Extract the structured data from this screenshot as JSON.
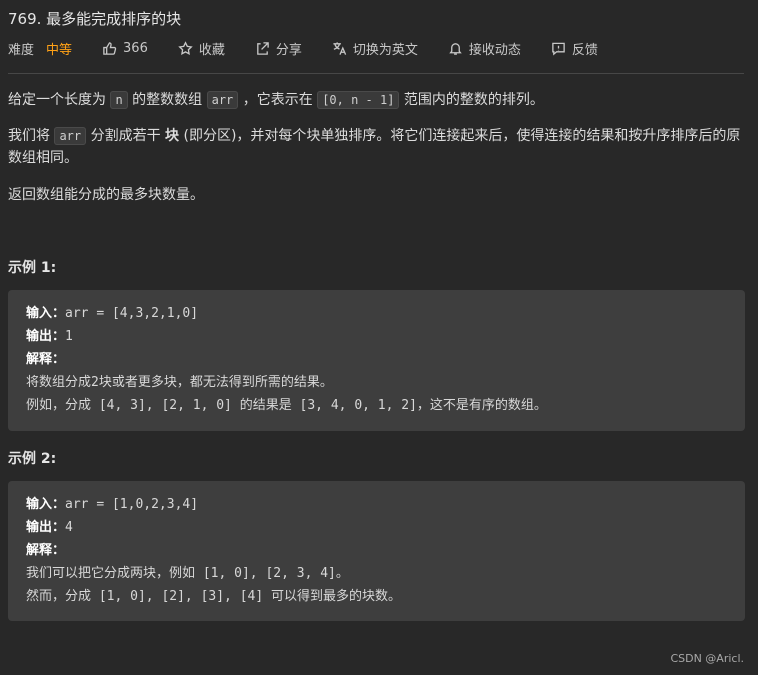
{
  "problem": {
    "title": "769. 最多能完成排序的块"
  },
  "meta": {
    "difficulty_label": "难度",
    "difficulty_value": "中等",
    "likes": "366",
    "favorite": "收藏",
    "share": "分享",
    "switch_lang": "切换为英文",
    "notify": "接收动态",
    "feedback": "反馈",
    "colors": {
      "difficulty": "#ffa116"
    }
  },
  "description": {
    "p1_a": "给定一个长度为",
    "p1_code1": "n",
    "p1_b": "的整数数组",
    "p1_code2": "arr",
    "p1_c": "，它表示在",
    "p1_code3": "[0, n - 1]",
    "p1_d": "范围内的整数的排列。",
    "p2_a": "我们将",
    "p2_code": "arr",
    "p2_b": "分割成若干",
    "p2_bold": "块",
    "p2_c": "(即分区)，并对每个块单独排序。将它们连接起来后，使得连接的结果和按升序排序后的原数组相同。",
    "p3": "返回数组能分成的最多块数量。"
  },
  "examples": [
    {
      "heading": "示例 1:",
      "input_label": "输入：",
      "input": "arr = [4,3,2,1,0]",
      "output_label": "输出：",
      "output": "1",
      "explain_label": "解释：",
      "explain1": "将数组分成2块或者更多块，都无法得到所需的结果。",
      "explain2": "例如，分成 [4, 3], [2, 1, 0] 的结果是 [3, 4, 0, 1, 2]，这不是有序的数组。"
    },
    {
      "heading": "示例 2:",
      "input_label": "输入：",
      "input": "arr = [1,0,2,3,4]",
      "output_label": "输出：",
      "output": "4",
      "explain_label": "解释：",
      "explain1": "我们可以把它分成两块，例如 [1, 0], [2, 3, 4]。",
      "explain2": "然而，分成 [1, 0], [2], [3], [4] 可以得到最多的块数。"
    }
  ],
  "watermark": "CSDN @Aricl."
}
